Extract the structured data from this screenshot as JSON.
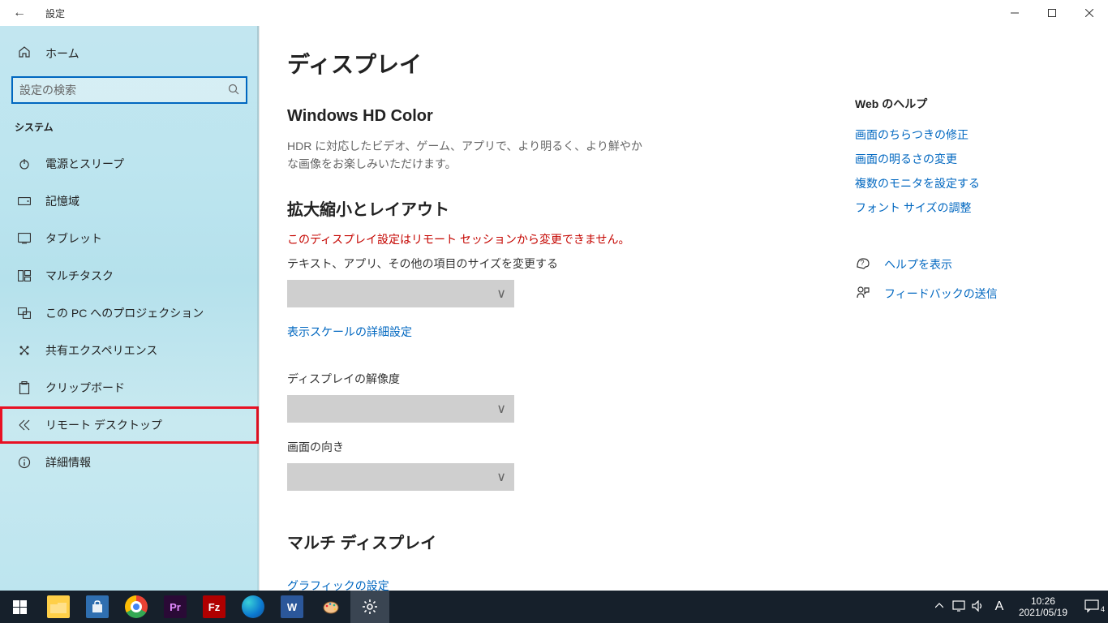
{
  "titlebar": {
    "title": "設定"
  },
  "sidebar": {
    "home": "ホーム",
    "search_placeholder": "設定の検索",
    "group": "システム",
    "items": [
      {
        "label": "電源とスリープ"
      },
      {
        "label": "記憶域"
      },
      {
        "label": "タブレット"
      },
      {
        "label": "マルチタスク"
      },
      {
        "label": "この PC へのプロジェクション"
      },
      {
        "label": "共有エクスペリエンス"
      },
      {
        "label": "クリップボード"
      },
      {
        "label": "リモート デスクトップ"
      },
      {
        "label": "詳細情報"
      }
    ]
  },
  "main": {
    "page_title": "ディスプレイ",
    "hd": {
      "heading": "Windows HD Color",
      "desc": "HDR に対応したビデオ、ゲーム、アプリで、より明るく、より鮮やかな画像をお楽しみいただけます。"
    },
    "scaling": {
      "heading": "拡大縮小とレイアウト",
      "warning": "このディスプレイ設定はリモート セッションから変更できません。",
      "size_label": "テキスト、アプリ、その他の項目のサイズを変更する",
      "advanced_link": "表示スケールの詳細設定",
      "resolution_label": "ディスプレイの解像度",
      "orientation_label": "画面の向き"
    },
    "multi": {
      "heading": "マルチ ディスプレイ",
      "graphics_link": "グラフィックの設定"
    }
  },
  "right": {
    "heading": "Web のヘルプ",
    "links": [
      "画面のちらつきの修正",
      "画面の明るさの変更",
      "複数のモニタを設定する",
      "フォント サイズの調整"
    ],
    "help": "ヘルプを表示",
    "feedback": "フィードバックの送信"
  },
  "taskbar": {
    "time": "10:26",
    "date": "2021/05/19",
    "ime": "A",
    "notif_count": "4"
  }
}
